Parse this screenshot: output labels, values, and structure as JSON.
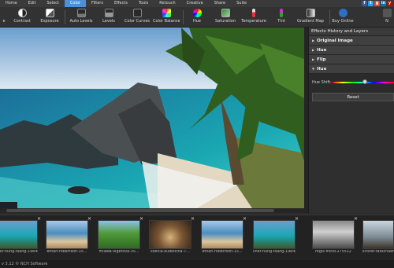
{
  "menu": {
    "items": [
      "Home",
      "Edit",
      "Select",
      "Color",
      "Filters",
      "Effects",
      "Tools",
      "Retouch",
      "Creative",
      "Share",
      "Suite"
    ],
    "active_index": 3
  },
  "social": [
    {
      "label": "f",
      "color": "#3b5998"
    },
    {
      "label": "t",
      "color": "#1da1f2"
    },
    {
      "label": "g",
      "color": "#dd4b39"
    },
    {
      "label": "in",
      "color": "#0077b5"
    },
    {
      "label": "y",
      "color": "#cc0000"
    }
  ],
  "toolbar": {
    "e": "e",
    "contrast": "Contrast",
    "exposure": "Exposure",
    "auto_levels": "Auto Levels",
    "levels": "Levels",
    "color_curves": "Color Curves",
    "color_balance": "Color Balance",
    "hue": "Hue",
    "saturation": "Saturation",
    "temperature": "Temperature",
    "tint": "Tint",
    "gradient_map": "Gradient Map",
    "buy_online": "Buy Online",
    "n": "N"
  },
  "panel": {
    "title": "Effects History and Layers",
    "original": "Original Image",
    "hue1": "Hue",
    "flip": "Flip",
    "hue2": "Hue",
    "hue_shift_label": "Hue Shift:",
    "hue_shift_value": 0.53,
    "reset": "Reset"
  },
  "filmstrip": [
    "chor-hung-tsang-19848",
    "ethan-robertson-15...",
    "milada-vigerova-35...",
    "ksenia-kudelkina-7...",
    "ethan-robertson-15...",
    "chor-hung-tsang-19848",
    "regis-frevd-275512",
    "kristof-rasschaert"
  ],
  "status": {
    "text": "v 3.12 © NCH Software"
  }
}
